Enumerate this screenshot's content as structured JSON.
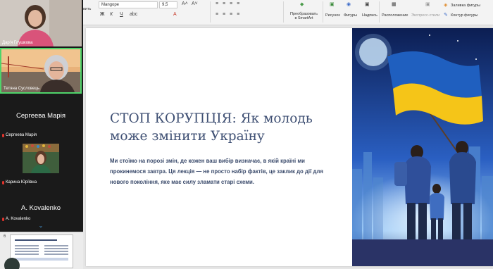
{
  "participants": [
    {
      "name": "Дар'я Глушкова"
    },
    {
      "name": "Тетяна Сусловець"
    },
    {
      "name": "Сергеева Марія",
      "display": "Сергеева Марія"
    },
    {
      "name": "Карина Юріївна"
    },
    {
      "name": "A. Kovalenko",
      "display": "A. Kovalenko"
    }
  ],
  "ribbon": {
    "left_label": "вить",
    "font_name": "Mangope",
    "font_size": "9,5",
    "bold": "Ж",
    "italic": "К",
    "underline": "Ч",
    "convert_smartart": "Преобразовать\nв SmartArt",
    "picture": "Рисунок",
    "shapes": "Фигуры",
    "textbox": "Надпись",
    "arrange": "Расположение",
    "quick_styles": "Экспресс-стили",
    "fill": "Заливка фигуры",
    "outline": "Контур фигуры"
  },
  "slide": {
    "title_part1": "СТОП КОРУПЦІЯ",
    "title_part2": ": Як молодь може змінити Україну",
    "body": "Ми стоїмо на порозі змін, де кожен ваш вибір визначає, в якій країні ми прокинемося завтра. Ця лекція — не просто набір фактів, це заклик до дії для нового покоління, яке має силу зламати старі схеми."
  },
  "thumbnail": {
    "number": "6"
  },
  "colors": {
    "title": "#3e4f73",
    "active_speaker": "#4fd46a",
    "muted_mic": "#e0342c",
    "flag_blue": "#1f5fbf",
    "flag_yellow": "#f5c518"
  }
}
